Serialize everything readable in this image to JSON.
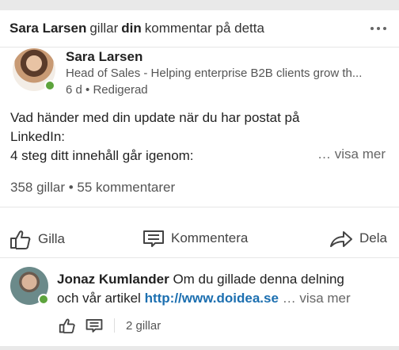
{
  "header": {
    "actor": "Sara Larsen",
    "verb": "gillar",
    "owner": "din",
    "rest": "kommentar på detta"
  },
  "post": {
    "author": "Sara Larsen",
    "headline": "Head of Sales - Helping enterprise B2B clients grow th...",
    "meta": "6 d • Redigerad",
    "lines": [
      "Vad händer med din update när du har postat på",
      "LinkedIn:",
      "4 steg ditt innehåll går igenom:"
    ],
    "see_more": "… visa mer",
    "counts": "358 gillar • 55 kommentarer"
  },
  "actions": {
    "like": "Gilla",
    "comment": "Kommentera",
    "share": "Dela"
  },
  "comment": {
    "author": "Jonaz Kumlander",
    "text_1": "Om du gillade denna delning",
    "text_2": "och vår artikel",
    "link": "http://www.doidea.se",
    "see_more": "… visa mer",
    "likes": "2 gillar"
  },
  "colors": {
    "link": "#1c6fb0",
    "online": "#5da43d"
  }
}
